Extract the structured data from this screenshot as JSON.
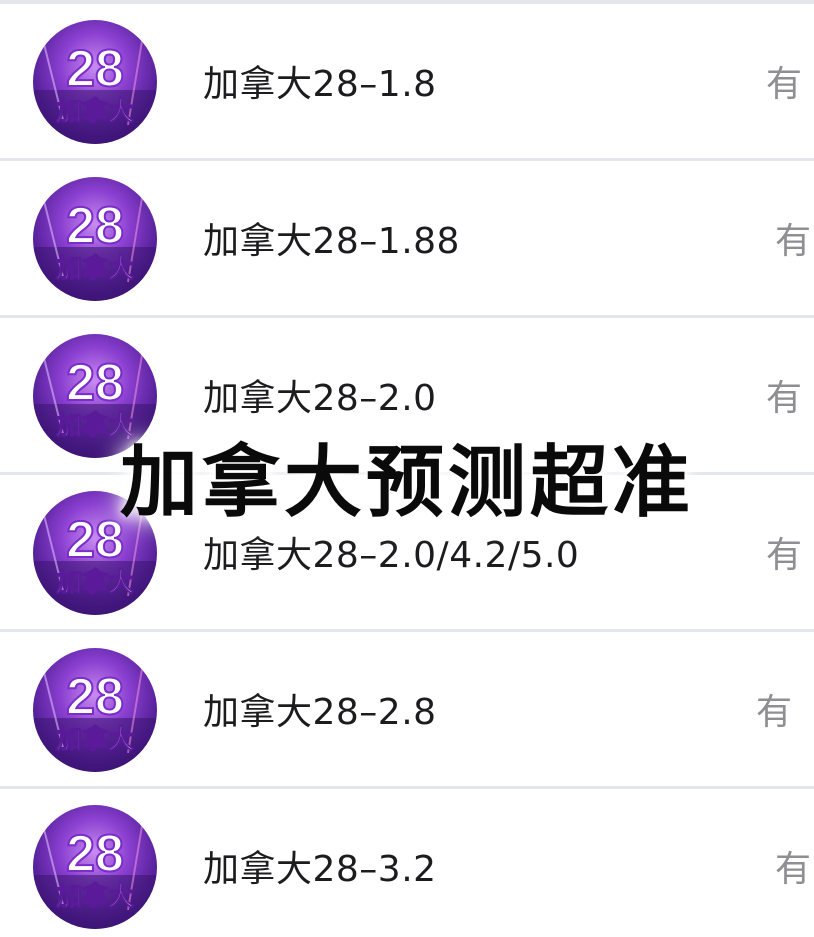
{
  "list": {
    "items": [
      {
        "title": "加拿大28–1.8",
        "status": "有",
        "avatar": {
          "number": "28",
          "caption": "加拿大"
        }
      },
      {
        "title": "加拿大28–1.88",
        "status": "有",
        "avatar": {
          "number": "28",
          "caption": "加拿大"
        }
      },
      {
        "title": "加拿大28–2.0",
        "status": "有",
        "avatar": {
          "number": "28",
          "caption": "加拿大"
        }
      },
      {
        "title": "加拿大28–2.0/4.2/5.0",
        "status": "有",
        "avatar": {
          "number": "28",
          "caption": "加拿大"
        }
      },
      {
        "title": "加拿大28–2.8",
        "status": "有",
        "avatar": {
          "number": "28",
          "caption": "加拿大"
        }
      },
      {
        "title": "加拿大28–3.2",
        "status": "有",
        "avatar": {
          "number": "28",
          "caption": "加拿大"
        }
      }
    ]
  },
  "overlay": {
    "caption": "加拿大预测超准"
  },
  "colors": {
    "divider": "#e4e6eb",
    "title": "#1c1c1e",
    "status": "#8e8e93",
    "avatar_bg": "#6a2bb8"
  }
}
